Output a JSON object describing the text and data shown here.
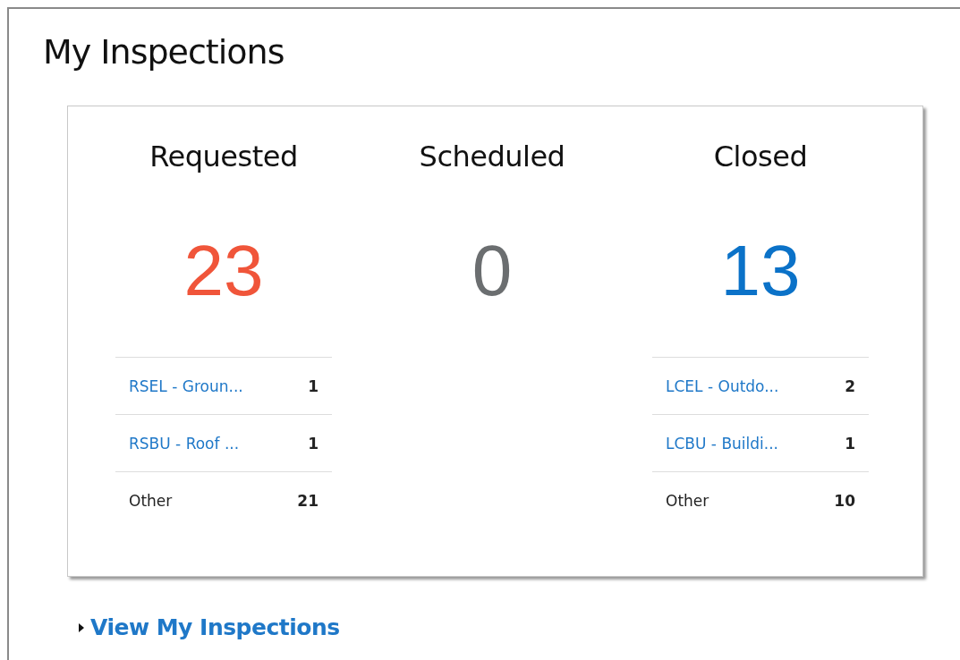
{
  "title": "My Inspections",
  "columns": [
    {
      "heading": "Requested",
      "count": "23",
      "color": "#f0553a",
      "rows": [
        {
          "kind": "link",
          "label": "RSEL - Groun...",
          "value": "1"
        },
        {
          "kind": "link",
          "label": "RSBU - Roof ...",
          "value": "1"
        },
        {
          "kind": "plain",
          "label": "Other",
          "value": "21"
        }
      ]
    },
    {
      "heading": "Scheduled",
      "count": "0",
      "color": "#6b6e70"
    },
    {
      "heading": "Closed",
      "count": "13",
      "color": "#0b72c8",
      "rows": [
        {
          "kind": "link",
          "label": "LCEL - Outdo...",
          "value": "2"
        },
        {
          "kind": "link",
          "label": "LCBU - Buildi...",
          "value": "1"
        },
        {
          "kind": "plain",
          "label": "Other",
          "value": "10"
        }
      ]
    }
  ],
  "footer_link": {
    "label": "View My Inspections",
    "expanded": false
  }
}
